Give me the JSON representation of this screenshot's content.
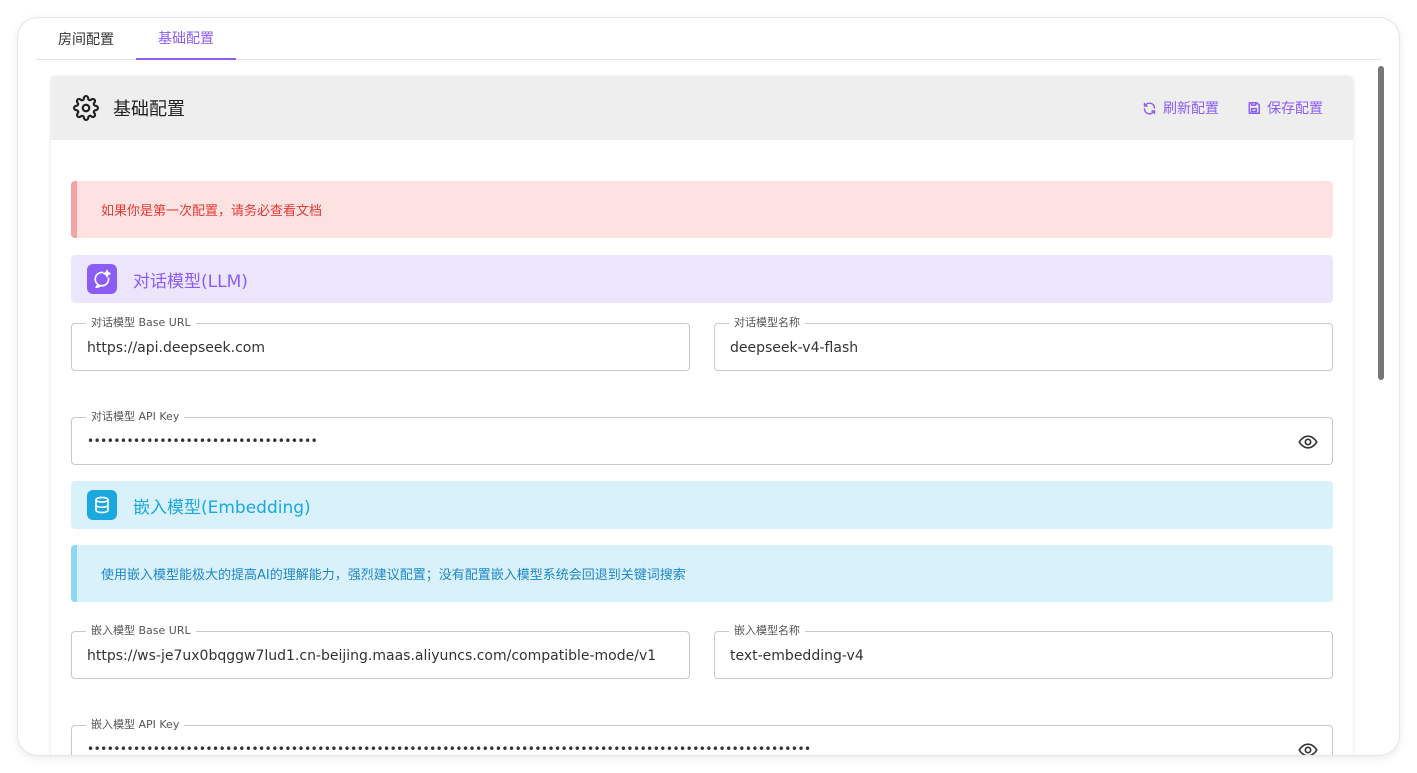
{
  "tabs": [
    {
      "label": "房间配置",
      "active": false
    },
    {
      "label": "基础配置",
      "active": true
    }
  ],
  "card": {
    "title": "基础配置",
    "refresh_label": "刷新配置",
    "save_label": "保存配置"
  },
  "alerts": {
    "first_time": "如果你是第一次配置，请务必查看文档",
    "embedding_hint": "使用嵌入模型能极大的提高AI的理解能力，强烈建议配置；没有配置嵌入模型系统会回退到关键词搜索"
  },
  "sections": {
    "llm": "对话模型(LLM)",
    "embedding": "嵌入模型(Embedding)"
  },
  "fields": {
    "llm_base_url": {
      "label": "对话模型 Base URL",
      "value": "https://api.deepseek.com"
    },
    "llm_model_name": {
      "label": "对话模型名称",
      "value": "deepseek-v4-flash"
    },
    "llm_api_key": {
      "label": "对话模型 API Key",
      "value": "•••••••••••••••••••••••••••••••••••"
    },
    "emb_base_url": {
      "label": "嵌入模型 Base URL",
      "value": "https://ws-je7ux0bqggw7lud1.cn-beijing.maas.aliyuncs.com/compatible-mode/v1"
    },
    "emb_model_name": {
      "label": "嵌入模型名称",
      "value": "text-embedding-v4"
    },
    "emb_api_key": {
      "label": "嵌入模型 API Key",
      "value": "••••••••••••••••••••••••••••••••••••••••••••••••••••••••••••••••••••••••••••••••••••••••••••••••••••••••••••••"
    }
  },
  "colors": {
    "accent": "#8b5cf6",
    "info": "#1ba7e0",
    "error": "#e53935"
  }
}
